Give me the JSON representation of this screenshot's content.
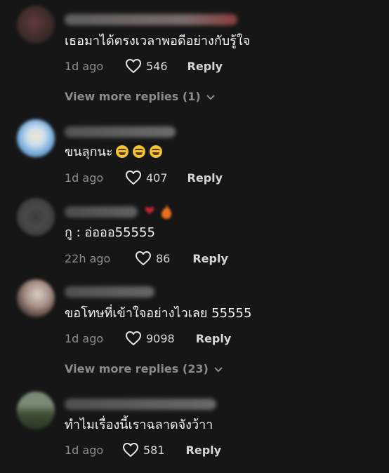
{
  "comments": [
    {
      "text": "เธอมาได้ตรงเวลาพอดีอย่างกับรู้ใจ",
      "time": "1d ago",
      "likes": "546",
      "reply_label": "Reply",
      "more_replies": "View more replies (1)"
    },
    {
      "text": "ขนลุกนะ",
      "time": "1d ago",
      "likes": "407",
      "reply_label": "Reply"
    },
    {
      "text": "กู : อ่อออ55555",
      "time": "22h ago",
      "likes": "86",
      "reply_label": "Reply"
    },
    {
      "text": "ขอโทษที่เข้าใจอย่างไวเลย 55555",
      "time": "1d ago",
      "likes": "9098",
      "reply_label": "Reply",
      "more_replies": "View more replies (23)"
    },
    {
      "text": "ทำไมเรื่องนี้เราฉลาดจังว้าา",
      "time": "1d ago",
      "likes": "581",
      "reply_label": "Reply"
    }
  ],
  "colors": {
    "background": "#161616",
    "text": "#f4f4f4",
    "muted": "#8e8e8e"
  },
  "icons": {
    "like": "heart-outline-icon",
    "expand": "chevron-down-icon",
    "emoji": "laughing-emoji-icon"
  }
}
